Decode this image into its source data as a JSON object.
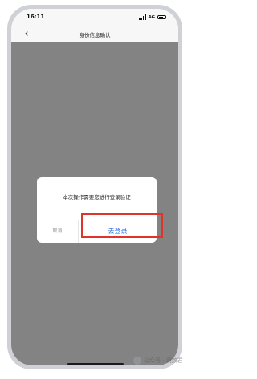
{
  "status_bar": {
    "time": "16:11",
    "network": "4G"
  },
  "nav": {
    "title": "身份信息确认",
    "back_icon": "chevron-left-icon"
  },
  "dialog": {
    "message": "本次操作需要您进行登录验证",
    "cancel_label": "取消",
    "confirm_label": "去登录"
  },
  "watermark": {
    "text": "公众号 · 澜数君"
  },
  "colors": {
    "overlay": "#838383",
    "confirm_text": "#2f6fe0",
    "highlight": "#e0342b"
  }
}
